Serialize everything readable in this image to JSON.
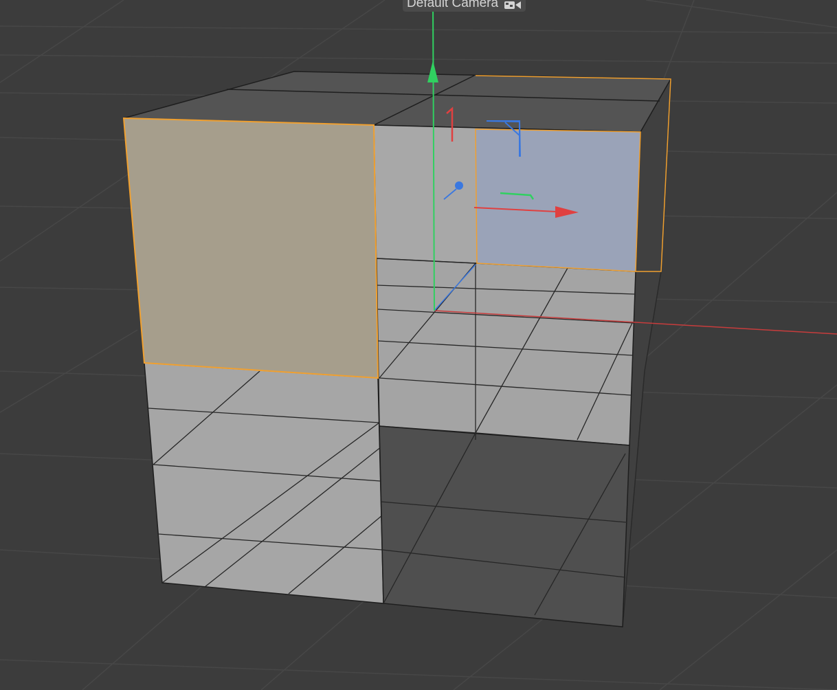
{
  "viewport": {
    "camera_label": "Default Camera",
    "camera_icon": "camera-icon"
  },
  "colors": {
    "background": "#3c3c3c",
    "grid_line": "#474747",
    "face_light": "#a6a6a6",
    "face_dark": "#4f4f4f",
    "face_top": "#545454",
    "selected_polygon_warm": "#a69e8c",
    "selected_polygon_cool": "#9aa3b8",
    "selection_outline": "#f0a030",
    "axis_x": "#e04040",
    "axis_y": "#30d060",
    "axis_z": "#3a78e0"
  },
  "scene": {
    "object": "cube-mesh",
    "selected_polygons": [
      "front-left-upper-polygon",
      "right-upper-polygon"
    ],
    "tool": "move-gizmo"
  }
}
